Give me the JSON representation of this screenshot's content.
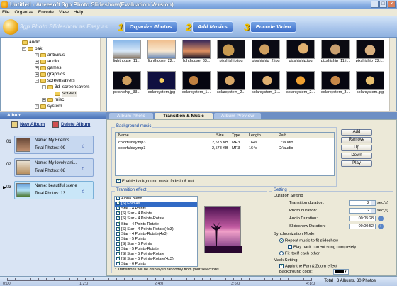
{
  "window": {
    "title": "Untitled - Aneesoft 3gp Photo Slideshow(Evaluation Version)"
  },
  "menu": [
    "File",
    "Organize",
    "Encode",
    "View",
    "Help"
  ],
  "banner": {
    "logo_text": "3gp Photo Slideshow as Easy as",
    "steps": [
      {
        "num": "1",
        "label": "Organize Photos"
      },
      {
        "num": "2",
        "label": "Add Musics"
      },
      {
        "num": "3",
        "label": "Encode Video"
      }
    ]
  },
  "tree": [
    {
      "label": "audio",
      "expand": ""
    },
    {
      "label": "bak",
      "expand": "-"
    },
    {
      "label": "antivirus",
      "expand": "+"
    },
    {
      "label": "audio",
      "expand": "+"
    },
    {
      "label": "games",
      "expand": "+"
    },
    {
      "label": "graphics",
      "expand": "+"
    },
    {
      "label": "screensavers",
      "expand": "-"
    },
    {
      "label": "3d_screensavers",
      "expand": "-"
    },
    {
      "label": "screen",
      "expand": ""
    },
    {
      "label": "misc",
      "expand": "+"
    },
    {
      "label": "system",
      "expand": "+"
    }
  ],
  "thumbnails": [
    [
      "lighthouse_11...",
      "lighthouse_22...",
      "lighthouse_33...",
      "pixshiship.jpg",
      "pixshiship_2.jpg",
      "pixshiship.jpg",
      "pixshiship_11.j...",
      "pixshiship_22.j..."
    ],
    [
      "pixshiship_33...",
      "solarsystem.jpg",
      "solarsystem_1...",
      "solarsystem_2...",
      "solarsystem_3...",
      "solarsystem_2...",
      "solarsystem_3...",
      "solarsystem.jpg"
    ]
  ],
  "album": {
    "header": "Album",
    "new_label": "New Album",
    "delete_label": "Delete Album",
    "items": [
      {
        "num": "01",
        "name": "Name: My Friends",
        "photos": "Total Photos: 09"
      },
      {
        "num": "02",
        "name": "Name: My lovely ani...",
        "photos": "Total Photos: 08"
      },
      {
        "num": "03",
        "name": "Name: beautiful scene",
        "photos": "Total Photos: 13"
      }
    ]
  },
  "tabs": [
    "Album Photo",
    "Transition & Music",
    "Album Preview"
  ],
  "music": {
    "group_title": "Background music",
    "columns": [
      "Name",
      "Size",
      "Type",
      "Length",
      "Path"
    ],
    "rows": [
      [
        "colorfulday.mp3",
        "2,578 KB",
        "MP3",
        "164s",
        "D:\\audio"
      ],
      [
        "colorfulday.mp3",
        "2,578 KB",
        "MP3",
        "164s",
        "D:\\audio"
      ]
    ],
    "buttons": [
      "Add",
      "Remove",
      "Up",
      "Down",
      "Play"
    ],
    "fade_label": "Enable background music fade-in & out"
  },
  "transition": {
    "group_title": "Transition effect",
    "items": [
      "Alpha Blend",
      "[S] Fold 4s",
      "Star - 4 Points",
      "[S] Star - 4 Points",
      "[S] Star - 4 Points-Rotate",
      "Star - 4 Points-Rotate",
      "[S] Star - 4 Points-Rotate(4x3)",
      "Star - 4 Points-Rotate(4x3)",
      "Star - 5 Points",
      "[S] Star - 5 Points",
      "Star - 5 Points-Rotate",
      "[S] Star - 5 Points-Rotate",
      "[S] Star - 5 Points-Rotate(4x3)",
      "Star - 6 Points"
    ],
    "selected_index": 1,
    "note": "* Transitions will be displayed randomly from your selections."
  },
  "setting": {
    "group_title": "Setting",
    "duration": {
      "title": "Duration Setting",
      "transition_label": "Transition duration:",
      "transition_value": "2",
      "photo_label": "Photo duration:",
      "photo_value": "2",
      "audio_label": "Audio Duration:",
      "audio_value": "00:05:28",
      "slideshow_label": "Slideshow Duration:",
      "slideshow_value": "00:00:52",
      "unit": "sec(s)"
    },
    "sync": {
      "title": "Synchronization Mode:",
      "opt1": "Repeat music to fit slideshow",
      "opt1_sub": "Play back current song completely",
      "opt2": "Fit itself each other"
    },
    "mask": {
      "title": "Mask Setting",
      "pan_label": "Apply the Pan & Zoom effect",
      "bg_label": "Background color:",
      "bg_color": "#000000"
    }
  },
  "timeline": {
    "ticks": [
      "0:00",
      "1:2:0",
      "2:4:0",
      "3:6:0",
      "4:8:0"
    ],
    "total": "Total : 3 Albums, 30 Photos"
  }
}
